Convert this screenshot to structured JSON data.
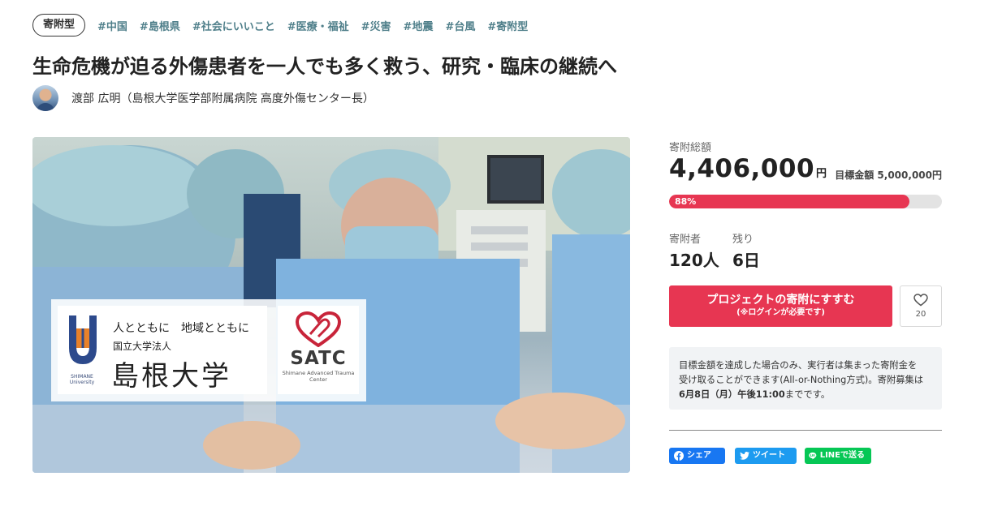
{
  "type_badge": "寄附型",
  "tags": [
    "#中国",
    "#島根県",
    "#社会にいいこと",
    "#医療・福祉",
    "#災害",
    "#地震",
    "#台風",
    "#寄附型"
  ],
  "title": "生命危機が迫る外傷患者を一人でも多く救う、研究・臨床の継続へ",
  "owner": "渡部 広明（島根大学医学部附属病院 高度外傷センター長）",
  "hero": {
    "slogan": "人とともに　地域とともに",
    "corp": "国立大学法人",
    "university": "島根大学",
    "emblem_text": "SHIMANE University",
    "satc": "SATC",
    "satc_sub": "Shimane Advanced Trauma Center"
  },
  "stats": {
    "total_label": "寄附総額",
    "total_amount": "4,406,000",
    "total_unit": "円",
    "goal_label": "目標金額",
    "goal_amount": "5,000,000円",
    "progress_percent": 88,
    "progress_text": "88%",
    "supporters_label": "寄附者",
    "supporters_value": "120人",
    "remaining_label": "残り",
    "remaining_value": "6日"
  },
  "actions": {
    "donate_main": "プロジェクトの寄附にすすむ",
    "donate_sub": "(※ログインが必要です)",
    "favorite_count": "20"
  },
  "note": {
    "line1": "目標金額を達成した場合のみ、実行者は集まった寄附金を",
    "line2": "受け取ることができます(All-or-Nothing方式)。寄附募集は",
    "deadline": "6月8日（月）午後11:00",
    "suffix": "までです。"
  },
  "share": {
    "facebook": "シェア",
    "twitter": "ツイート",
    "line": "LINEで送る"
  },
  "colors": {
    "accent": "#e73652",
    "tag": "#4f7f8a",
    "facebook": "#1877f2",
    "twitter": "#1d9bf0",
    "line": "#06c755"
  }
}
